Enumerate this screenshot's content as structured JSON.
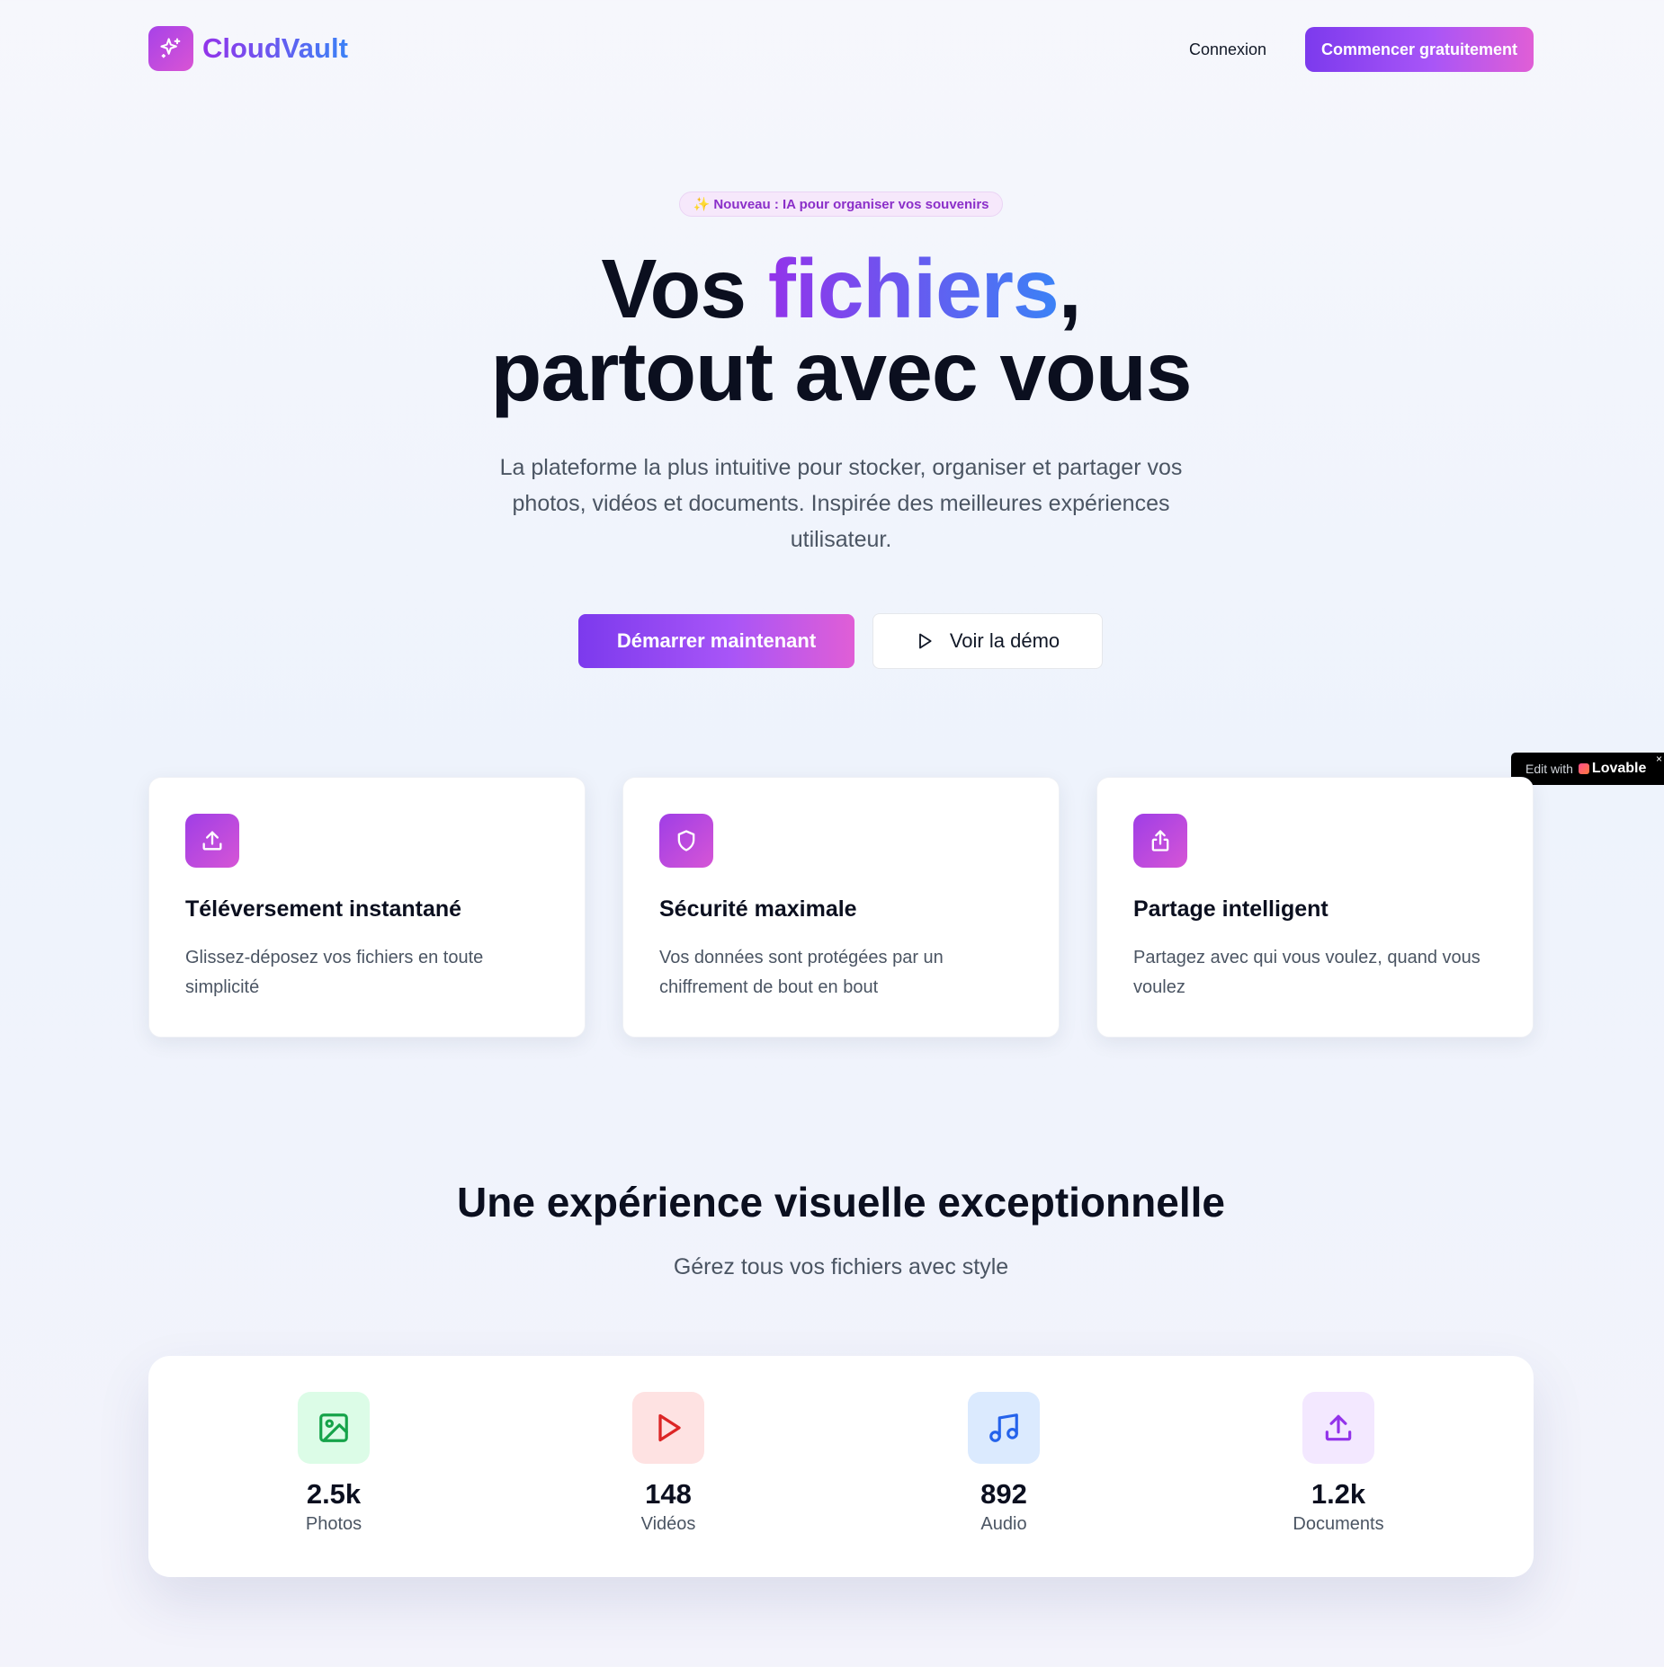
{
  "header": {
    "brand": "CloudVault",
    "login_label": "Connexion",
    "cta_label": "Commencer gratuitement",
    "logo_icon": "sparkles-icon"
  },
  "hero": {
    "badge": "✨ Nouveau : IA pour organiser vos souvenirs",
    "title_before": "Vos ",
    "title_highlight": "fichiers",
    "title_after": ",",
    "title_line2": "partout avec vous",
    "subtitle": "La plateforme la plus intuitive pour stocker, organiser et partager vos photos, vidéos et documents. Inspirée des meilleures expériences utilisateur.",
    "primary_button": "Démarrer maintenant",
    "secondary_button": "Voir la démo",
    "secondary_icon": "play-icon"
  },
  "lovable_badge": {
    "prefix": "Edit with",
    "name": "Lovable",
    "close": "×"
  },
  "features": [
    {
      "icon": "upload-icon",
      "title": "Téléversement instantané",
      "description": "Glissez-déposez vos fichiers en toute simplicité"
    },
    {
      "icon": "shield-icon",
      "title": "Sécurité maximale",
      "description": "Vos données sont protégées par un chiffrement de bout en bout"
    },
    {
      "icon": "share-icon",
      "title": "Partage intelligent",
      "description": "Partagez avec qui vous voulez, quand vous voulez"
    }
  ],
  "section": {
    "title": "Une expérience visuelle exceptionnelle",
    "subtitle": "Gérez tous vos fichiers avec style"
  },
  "stats": [
    {
      "icon": "image-icon",
      "value": "2.5k",
      "label": "Photos",
      "color": "#16a34a",
      "bg": "#dcfce7"
    },
    {
      "icon": "play-icon",
      "value": "148",
      "label": "Vidéos",
      "color": "#dc2626",
      "bg": "#fee2e2"
    },
    {
      "icon": "music-icon",
      "value": "892",
      "label": "Audio",
      "color": "#2563eb",
      "bg": "#dbeafe"
    },
    {
      "icon": "upload-icon",
      "value": "1.2k",
      "label": "Documents",
      "color": "#9333ea",
      "bg": "#f3e8ff"
    }
  ],
  "colors": {
    "brand_gradient_start": "#7c3aed",
    "brand_gradient_end": "#e05ed6",
    "heading": "#0b0f1f",
    "body_text": "#4b5563"
  }
}
